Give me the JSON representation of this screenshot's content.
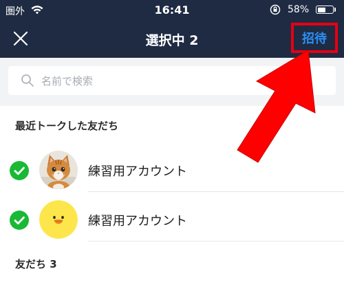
{
  "status_bar": {
    "carrier": "圏外",
    "time": "16:41",
    "battery_percent": "58%",
    "battery_level": 0.58
  },
  "nav": {
    "title": "選択中 2",
    "invite_label": "招待",
    "invite_color": "#2b8ff5",
    "highlight_color": "#e60012"
  },
  "search": {
    "placeholder": "名前で検索",
    "value": ""
  },
  "sections": {
    "recent_title": "最近トークした友だち",
    "friends_title": "友だち 3"
  },
  "friends": [
    {
      "name": "練習用アカウント",
      "selected": true,
      "avatar": "kitten-photo"
    },
    {
      "name": "練習用アカウント",
      "selected": true,
      "avatar": "sally-chick-icon"
    }
  ],
  "colors": {
    "header_bg": "#1f2b43",
    "check_green": "#19b935",
    "arrow_red": "#ff0000"
  }
}
